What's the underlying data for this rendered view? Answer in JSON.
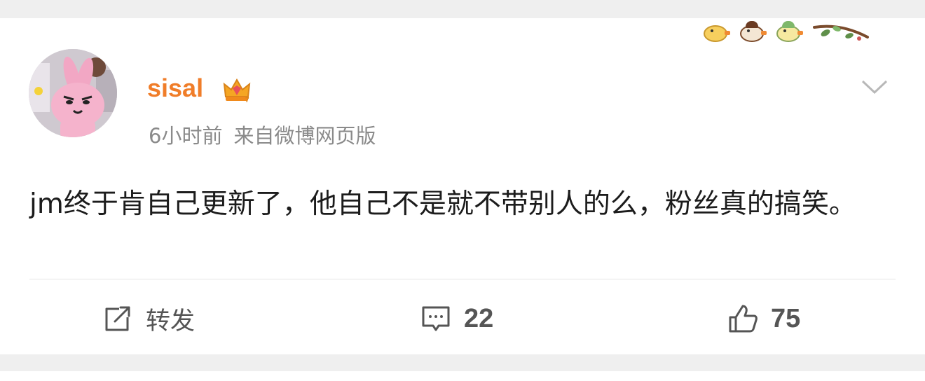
{
  "post": {
    "username": "sisal",
    "time": "6小时前",
    "source": "来自微博网页版",
    "text": "jm终于肯自己更新了，他自己不是就不带别人的么，粉丝真的搞笑。"
  },
  "actions": {
    "repost_label": "转发",
    "comment_count": "22",
    "like_count": "75"
  },
  "icons": {
    "crown": "vip-crown-icon",
    "chevron": "chevron-down-icon",
    "repost": "repost-icon",
    "comment": "comment-icon",
    "like": "thumbs-up-icon"
  },
  "colors": {
    "username": "#f07d29",
    "meta": "#8a8a8a",
    "text": "#1c1c1c",
    "action": "#555555",
    "background": "#efefef",
    "card": "#ffffff"
  }
}
